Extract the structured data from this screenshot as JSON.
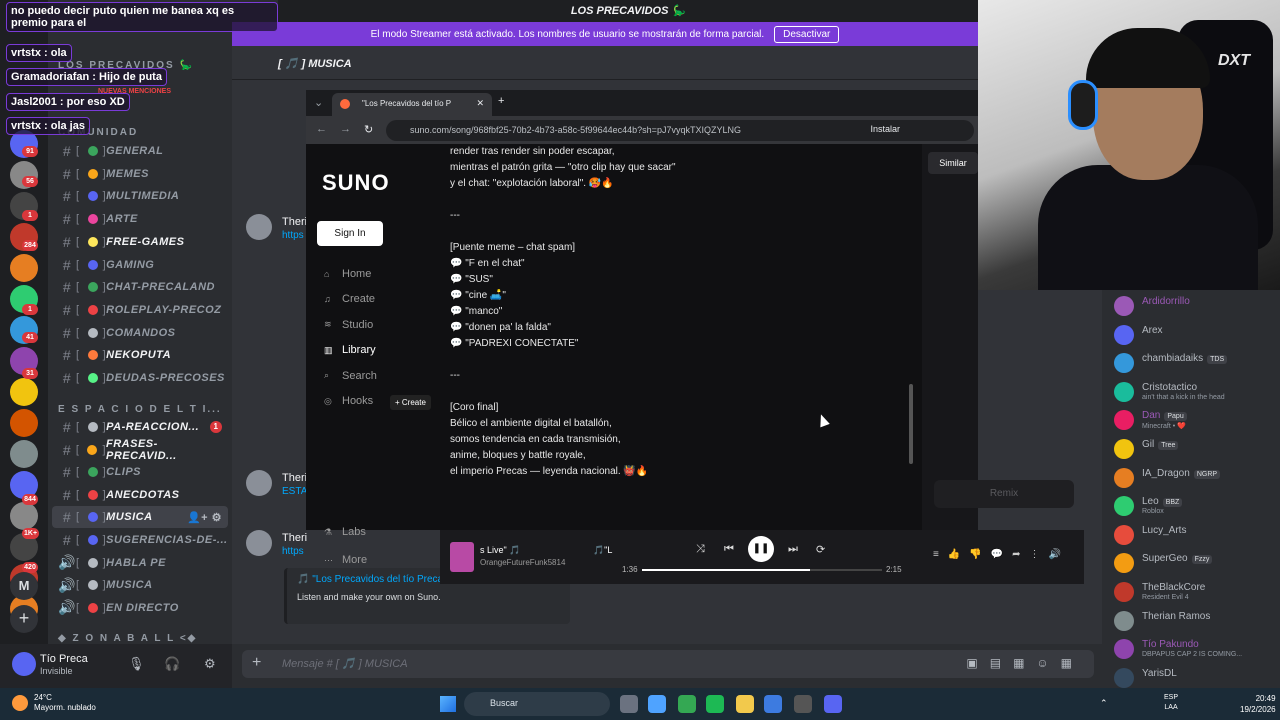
{
  "server": {
    "name": "LOS PRECAVIDOS 🦕",
    "rail_badges": [
      "91",
      "56",
      "1",
      "284",
      "41",
      "31",
      "1",
      "844",
      "1K+",
      "420"
    ],
    "letter": "M"
  },
  "channels": {
    "category_community": "COMUNIDAD",
    "mentions_label": "NUEVAS MENCIONES",
    "items": [
      {
        "label": "GENERAL",
        "color": "#3ba55d"
      },
      {
        "label": "MEMES",
        "color": "#faa61a"
      },
      {
        "label": "MULTIMEDIA",
        "color": "#5865f2"
      },
      {
        "label": "ARTE",
        "color": "#eb459e"
      },
      {
        "label": "FREE-GAMES",
        "color": "#fee75c"
      },
      {
        "label": "GAMING",
        "color": "#5865f2"
      },
      {
        "label": "CHAT-PRECALAND",
        "color": "#3ba55d"
      },
      {
        "label": "ROLEPLAY-PRECOZ",
        "color": "#ed4245"
      },
      {
        "label": "COMANDOS",
        "color": "#b5bac1"
      },
      {
        "label": "NEKOPUTA",
        "color": "#ff7a3c"
      },
      {
        "label": "DEUDAS-PRECOSES",
        "color": "#57f287"
      }
    ],
    "category_espacio": "E S P A C I O D E L T I...",
    "items2": [
      {
        "label": "PA-REACCION...",
        "color": "#b5bac1",
        "unread": "1"
      },
      {
        "label": "FRASES-PRECAVID...",
        "color": "#faa61a"
      },
      {
        "label": "CLIPS",
        "color": "#3ba55d"
      },
      {
        "label": "ANECDOTAS",
        "color": "#ed4245"
      },
      {
        "label": "MUSICA",
        "color": "#5865f2"
      },
      {
        "label": "SUGERENCIAS-DE-...",
        "color": "#5865f2"
      },
      {
        "label": "HABLA PE",
        "color": "#b5bac1"
      },
      {
        "label": "MUSICA",
        "color": "#b5bac1"
      },
      {
        "label": "EN DIRECTO",
        "color": "#ed4245"
      }
    ],
    "category_zona": "◆ Z O N A B A L L <◆"
  },
  "user": {
    "name": "Tío Preca",
    "status": "Invisible"
  },
  "streamer_mode": {
    "text": "El modo Streamer está activado. Los nombres de usuario se mostrarán de forma parcial.",
    "button": "Desactivar"
  },
  "chat": {
    "channel_header": "[ 🎵 ] MUSICA",
    "messages": [
      {
        "name": "Theri",
        "line": "https"
      },
      {
        "name": "Theri",
        "line": "ESTA"
      },
      {
        "name": "Theri",
        "line": "https"
      }
    ],
    "embed_title": "🎵 \"Los Precavidos del tío Precas Live\" 🎵",
    "embed_desc": "Listen and make your own on Suno.",
    "composer_placeholder": "Mensaje # [ 🎵 ] MUSICA"
  },
  "overlay_chat": [
    "no puedo decir puto quien me banea xq es premio para el",
    "vrtstx : ola",
    "Gramadoriafan : Hijo de puta",
    "Jasl2001 : por eso XD",
    "vrtstx : ola jas"
  ],
  "browser": {
    "tab_title": "\"Los Precavidos del tío P",
    "url": "suno.com/song/968fbf25-70b2-4b73-a58c-5f99644ec44b?sh=pJ7vyqkTXIQZYLNG",
    "install": "Instalar"
  },
  "suno": {
    "logo": "SUNO",
    "sign_in": "Sign In",
    "nav": [
      "Home",
      "Create",
      "Studio",
      "Library",
      "Search",
      "Hooks"
    ],
    "nav_selected": "Library",
    "create_pill": "+ Create",
    "bottom_nav": [
      "Labs",
      "More"
    ],
    "similar": "Similar",
    "remix": "Remix",
    "lyrics": [
      "render tras render sin poder escapar,",
      "mientras el patrón grita — \"otro clip hay que sacar\"",
      "y el chat: \"explotación laboral\". 🥵🔥",
      "",
      "---",
      "",
      "[Puente meme – chat spam]",
      "💬 \"F en el chat\"",
      "💬 \"SUS\"",
      "💬 \"cine 🛋️\"",
      "💬 \"manco\"",
      "💬 \"donen pa' la falda\"",
      "💬 \"PADREXI CONECTATE\"",
      "",
      "---",
      "",
      "[Coro final]",
      "Bélico el ambiente digital el batallón,",
      "somos tendencia en cada transmisión,",
      "anime, bloques y battle royale,",
      "el imperio Precas — leyenda nacional. 👹🔥"
    ]
  },
  "player": {
    "title": "s Live\" 🎵",
    "title2": "🎵\"L",
    "artist": "OrangeFutureFunk5814",
    "elapsed": "1:36",
    "total": "2:15",
    "progress": 0.7
  },
  "members": [
    {
      "name": "Ardidorrillo",
      "color": "#9b59b6",
      "sub": "",
      "tag": ""
    },
    {
      "name": "Arex",
      "color": "#b5bac1",
      "sub": "",
      "tag": ""
    },
    {
      "name": "chambiadaiks",
      "color": "#b5bac1",
      "sub": "",
      "tag": "TDS"
    },
    {
      "name": "Cristotactico",
      "color": "#b5bac1",
      "sub": "ain't that a kick in the head",
      "tag": ""
    },
    {
      "name": "Dan",
      "color": "#9b59b6",
      "sub": "Minecraft • ❤️",
      "tag": "Papu"
    },
    {
      "name": "Gil",
      "color": "#b5bac1",
      "sub": "",
      "tag": "Tree"
    },
    {
      "name": "IA_Dragon",
      "color": "#b5bac1",
      "sub": "",
      "tag": "NGRP"
    },
    {
      "name": "Leo",
      "color": "#b5bac1",
      "sub": "Roblox",
      "tag": "BBZ"
    },
    {
      "name": "Lucy_Arts",
      "color": "#b5bac1",
      "sub": "",
      "tag": ""
    },
    {
      "name": "SuperGeo",
      "color": "#b5bac1",
      "sub": "",
      "tag": "Fzzy"
    },
    {
      "name": "TheBlackCore",
      "color": "#b5bac1",
      "sub": "Resident Evil 4",
      "tag": ""
    },
    {
      "name": "Therian Ramos",
      "color": "#b5bac1",
      "sub": "",
      "tag": ""
    },
    {
      "name": "Tío Pakundo",
      "color": "#9b59b6",
      "sub": "DBPAPUS CAP 2 IS COMING...",
      "tag": ""
    },
    {
      "name": "YarisDL",
      "color": "#b5bac1",
      "sub": "",
      "tag": ""
    }
  ],
  "taskbar": {
    "temp": "24°C",
    "weather": "Mayorm. nublado",
    "search": "Buscar",
    "lang1": "ESP",
    "lang2": "LAA",
    "time": "20:49",
    "date": "19/2/2026"
  },
  "webcam": {
    "chair_logo": "DXT"
  }
}
